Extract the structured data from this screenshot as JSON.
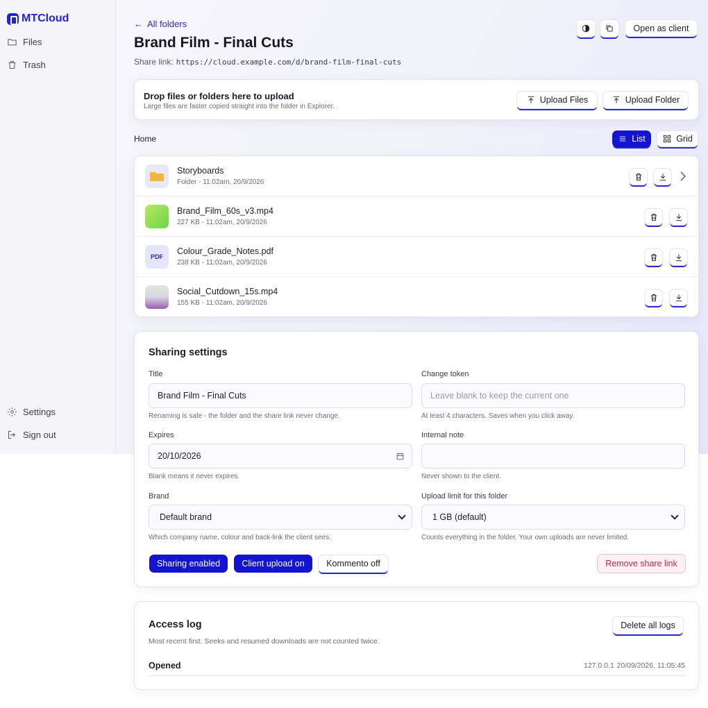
{
  "app": {
    "name": "MTCloud"
  },
  "sidebar": {
    "items": [
      {
        "label": "Files",
        "icon": "folder-icon"
      },
      {
        "label": "Trash",
        "icon": "trash-icon"
      }
    ],
    "bottom": [
      {
        "label": "Settings",
        "icon": "gear-icon"
      },
      {
        "label": "Sign out",
        "icon": "sign-out-icon"
      }
    ]
  },
  "header": {
    "back_label": "All folders",
    "title": "Brand Film - Final Cuts",
    "share_label": "Share link:",
    "share_url": "https://cloud.example.com/d/brand-film-final-cuts",
    "open_client_label": "Open as client"
  },
  "upload": {
    "heading": "Drop files or folders here to upload",
    "subtext": "Large files are faster copied straight into the folder in Explorer.",
    "files_label": "Upload Files",
    "folder_label": "Upload Folder"
  },
  "browser": {
    "breadcrumb": "Home",
    "view_list_label": "List",
    "view_grid_label": "Grid",
    "selected_view": "List"
  },
  "files": [
    {
      "name": "Storyboards",
      "meta": "Folder - 11:02am, 20/9/2026",
      "kind": "folder"
    },
    {
      "name": "Brand_Film_60s_v3.mp4",
      "meta": "227 KB - 11:02am, 20/9/2026",
      "kind": "video-green"
    },
    {
      "name": "Colour_Grade_Notes.pdf",
      "meta": "238 KB - 11:02am, 20/9/2026",
      "kind": "pdf",
      "badge": "PDF"
    },
    {
      "name": "Social_Cutdown_15s.mp4",
      "meta": "155 KB - 11:02am, 20/9/2026",
      "kind": "video-purple"
    }
  ],
  "sharing": {
    "heading": "Sharing settings",
    "title_label": "Title",
    "title_value": "Brand Film - Final Cuts",
    "title_hint": "Renaming is safe - the folder and the share link never change.",
    "token_label": "Change token",
    "token_placeholder": "Leave blank to keep the current one",
    "token_hint": "At least 4 characters. Saves when you click away.",
    "expires_label": "Expires",
    "expires_value": "20/10/2026",
    "expires_hint": "Blank means it never expires.",
    "note_label": "Internal note",
    "note_value": "",
    "note_hint": "Never shown to the client.",
    "brand_label": "Brand",
    "brand_value": "Default brand",
    "brand_hint": "Which company name, colour and back-link the client sees.",
    "limit_label": "Upload limit for this folder",
    "limit_value": "1 GB (default)",
    "limit_hint": "Counts everything in the folder. Your own uploads are never limited.",
    "sharing_toggle": "Sharing enabled",
    "upload_toggle": "Client upload on",
    "kommento_toggle": "Kommento off",
    "remove_label": "Remove share link"
  },
  "access_log": {
    "heading": "Access log",
    "subtext": "Most recent first. Seeks and resumed downloads are not counted twice.",
    "delete_label": "Delete all logs",
    "entries": [
      {
        "event": "Opened",
        "ip": "127.0.0.1",
        "time": "20/09/2026, 11:05:45"
      }
    ]
  },
  "colors": {
    "accent": "#1414d0",
    "danger": "#c0285a"
  }
}
